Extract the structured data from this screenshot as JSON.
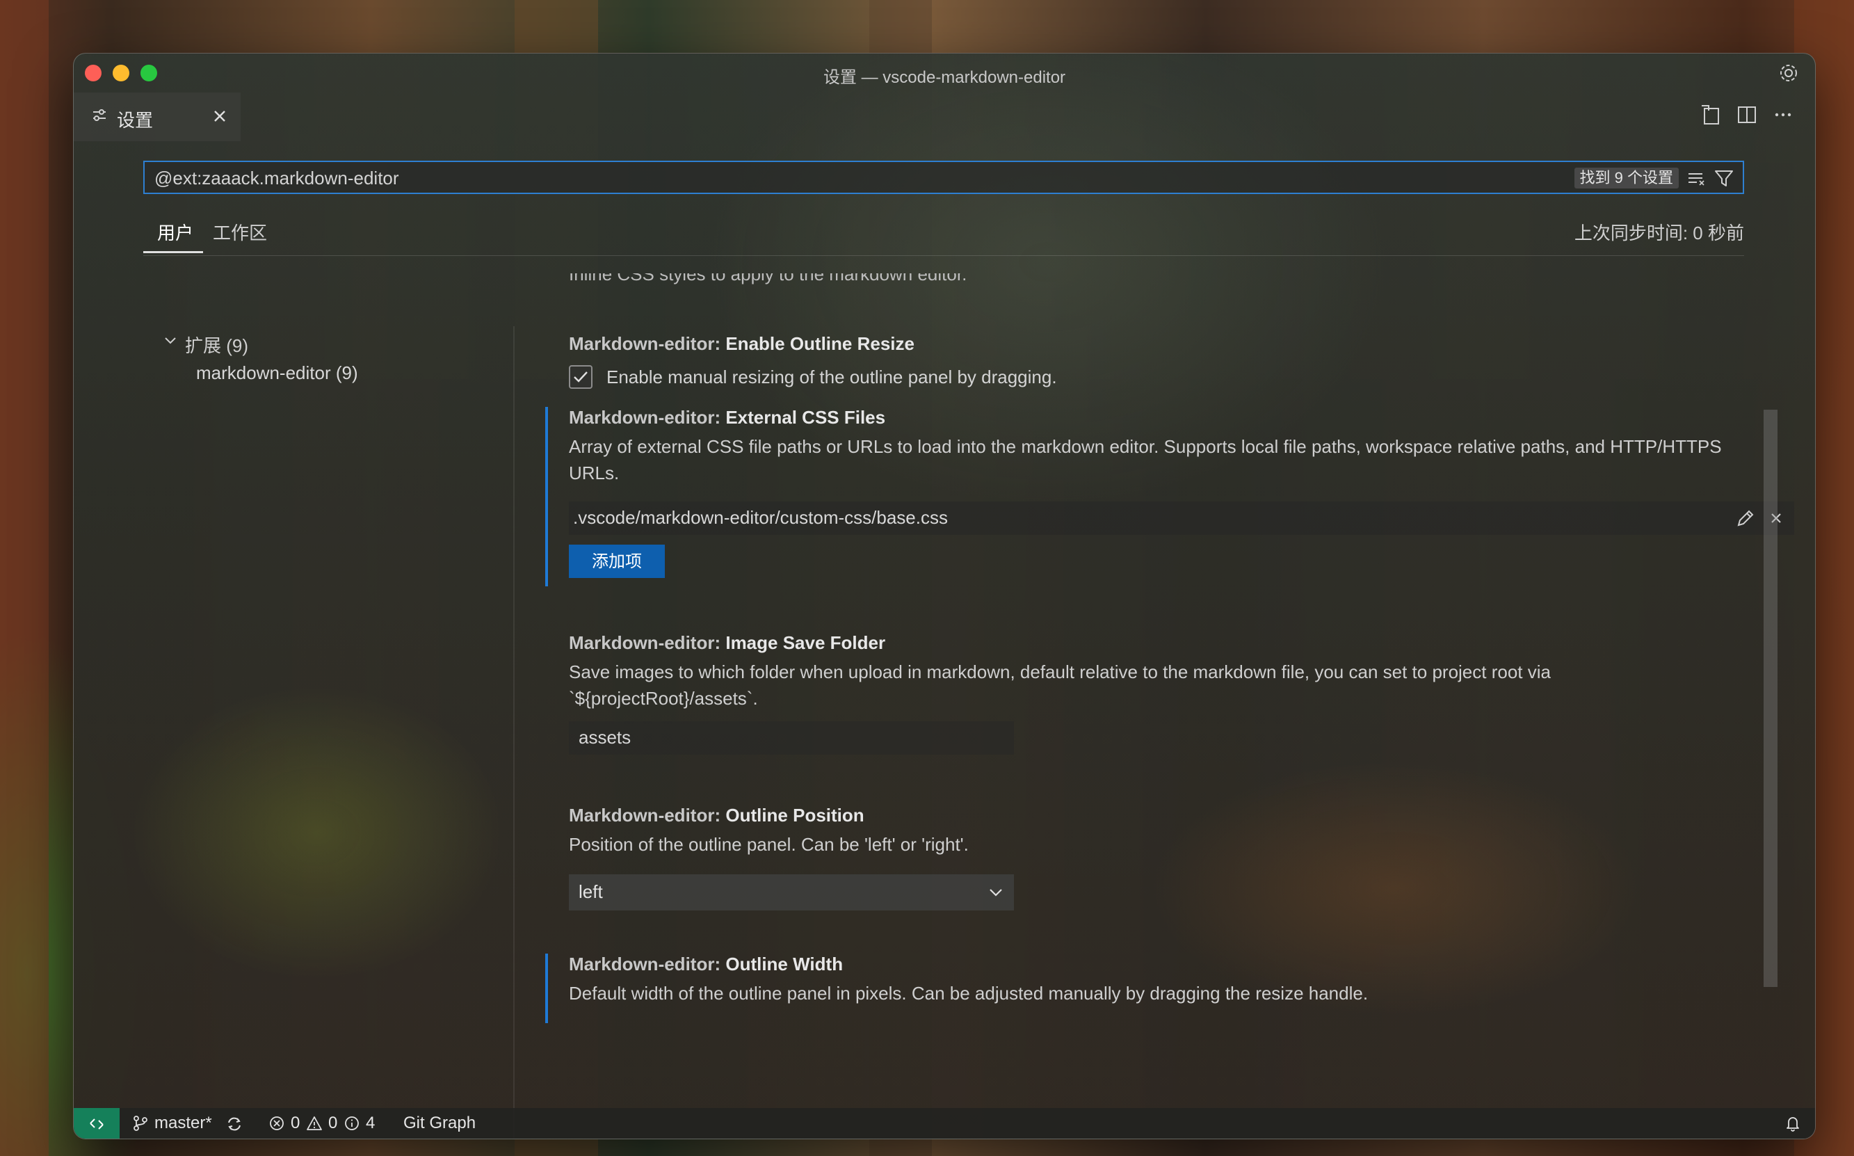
{
  "window": {
    "title": "设置 — vscode-markdown-editor"
  },
  "tab": {
    "label": "设置"
  },
  "search": {
    "value": "@ext:zaaack.markdown-editor",
    "result_count": "找到 9 个设置"
  },
  "scopes": {
    "user": "用户",
    "workspace": "工作区",
    "sync_time": "上次同步时间: 0 秒前"
  },
  "toc": {
    "group": "扩展 (9)",
    "item": "markdown-editor (9)"
  },
  "settings": {
    "cut_off_text": "Inline CSS styles to apply to the markdown editor.",
    "category": "Markdown-editor:",
    "outline_resize": {
      "title": "Enable Outline Resize",
      "checkbox_label": "Enable manual resizing of the outline panel by dragging.",
      "checked": true
    },
    "external_css": {
      "title": "External CSS Files",
      "description": "Array of external CSS file paths or URLs to load into the markdown editor. Supports local file paths, workspace relative paths, and HTTP/HTTPS URLs.",
      "items": [
        ".vscode/markdown-editor/custom-css/base.css"
      ],
      "add_button": "添加项"
    },
    "image_save_folder": {
      "title": "Image Save Folder",
      "description": "Save images to which folder when upload in markdown, default relative to the markdown file, you can set to project root via `${projectRoot}/assets`.",
      "value": "assets"
    },
    "outline_position": {
      "title": "Outline Position",
      "description": "Position of the outline panel. Can be 'left' or 'right'.",
      "value": "left"
    },
    "outline_width": {
      "title": "Outline Width",
      "description": "Default width of the outline panel in pixels. Can be adjusted manually by dragging the resize handle."
    }
  },
  "statusbar": {
    "branch": "master*",
    "errors": "0",
    "warnings": "0",
    "infos": "4",
    "git_graph": "Git Graph"
  },
  "icons": [
    "gear-icon",
    "settings-tab-icon",
    "close-icon",
    "open-json-icon",
    "split-editor-icon",
    "more-actions-icon",
    "clear-filter-icon",
    "filter-icon",
    "chevron-down-icon",
    "pencil-icon",
    "remote-icon",
    "branch-icon",
    "sync-icon",
    "error-icon",
    "warning-icon",
    "info-icon",
    "bell-icon"
  ],
  "colors": {
    "accent": "#2e7fd1",
    "button": "#0e5fae",
    "remote": "#15805a",
    "modified_bar": "#1f7ad6"
  }
}
